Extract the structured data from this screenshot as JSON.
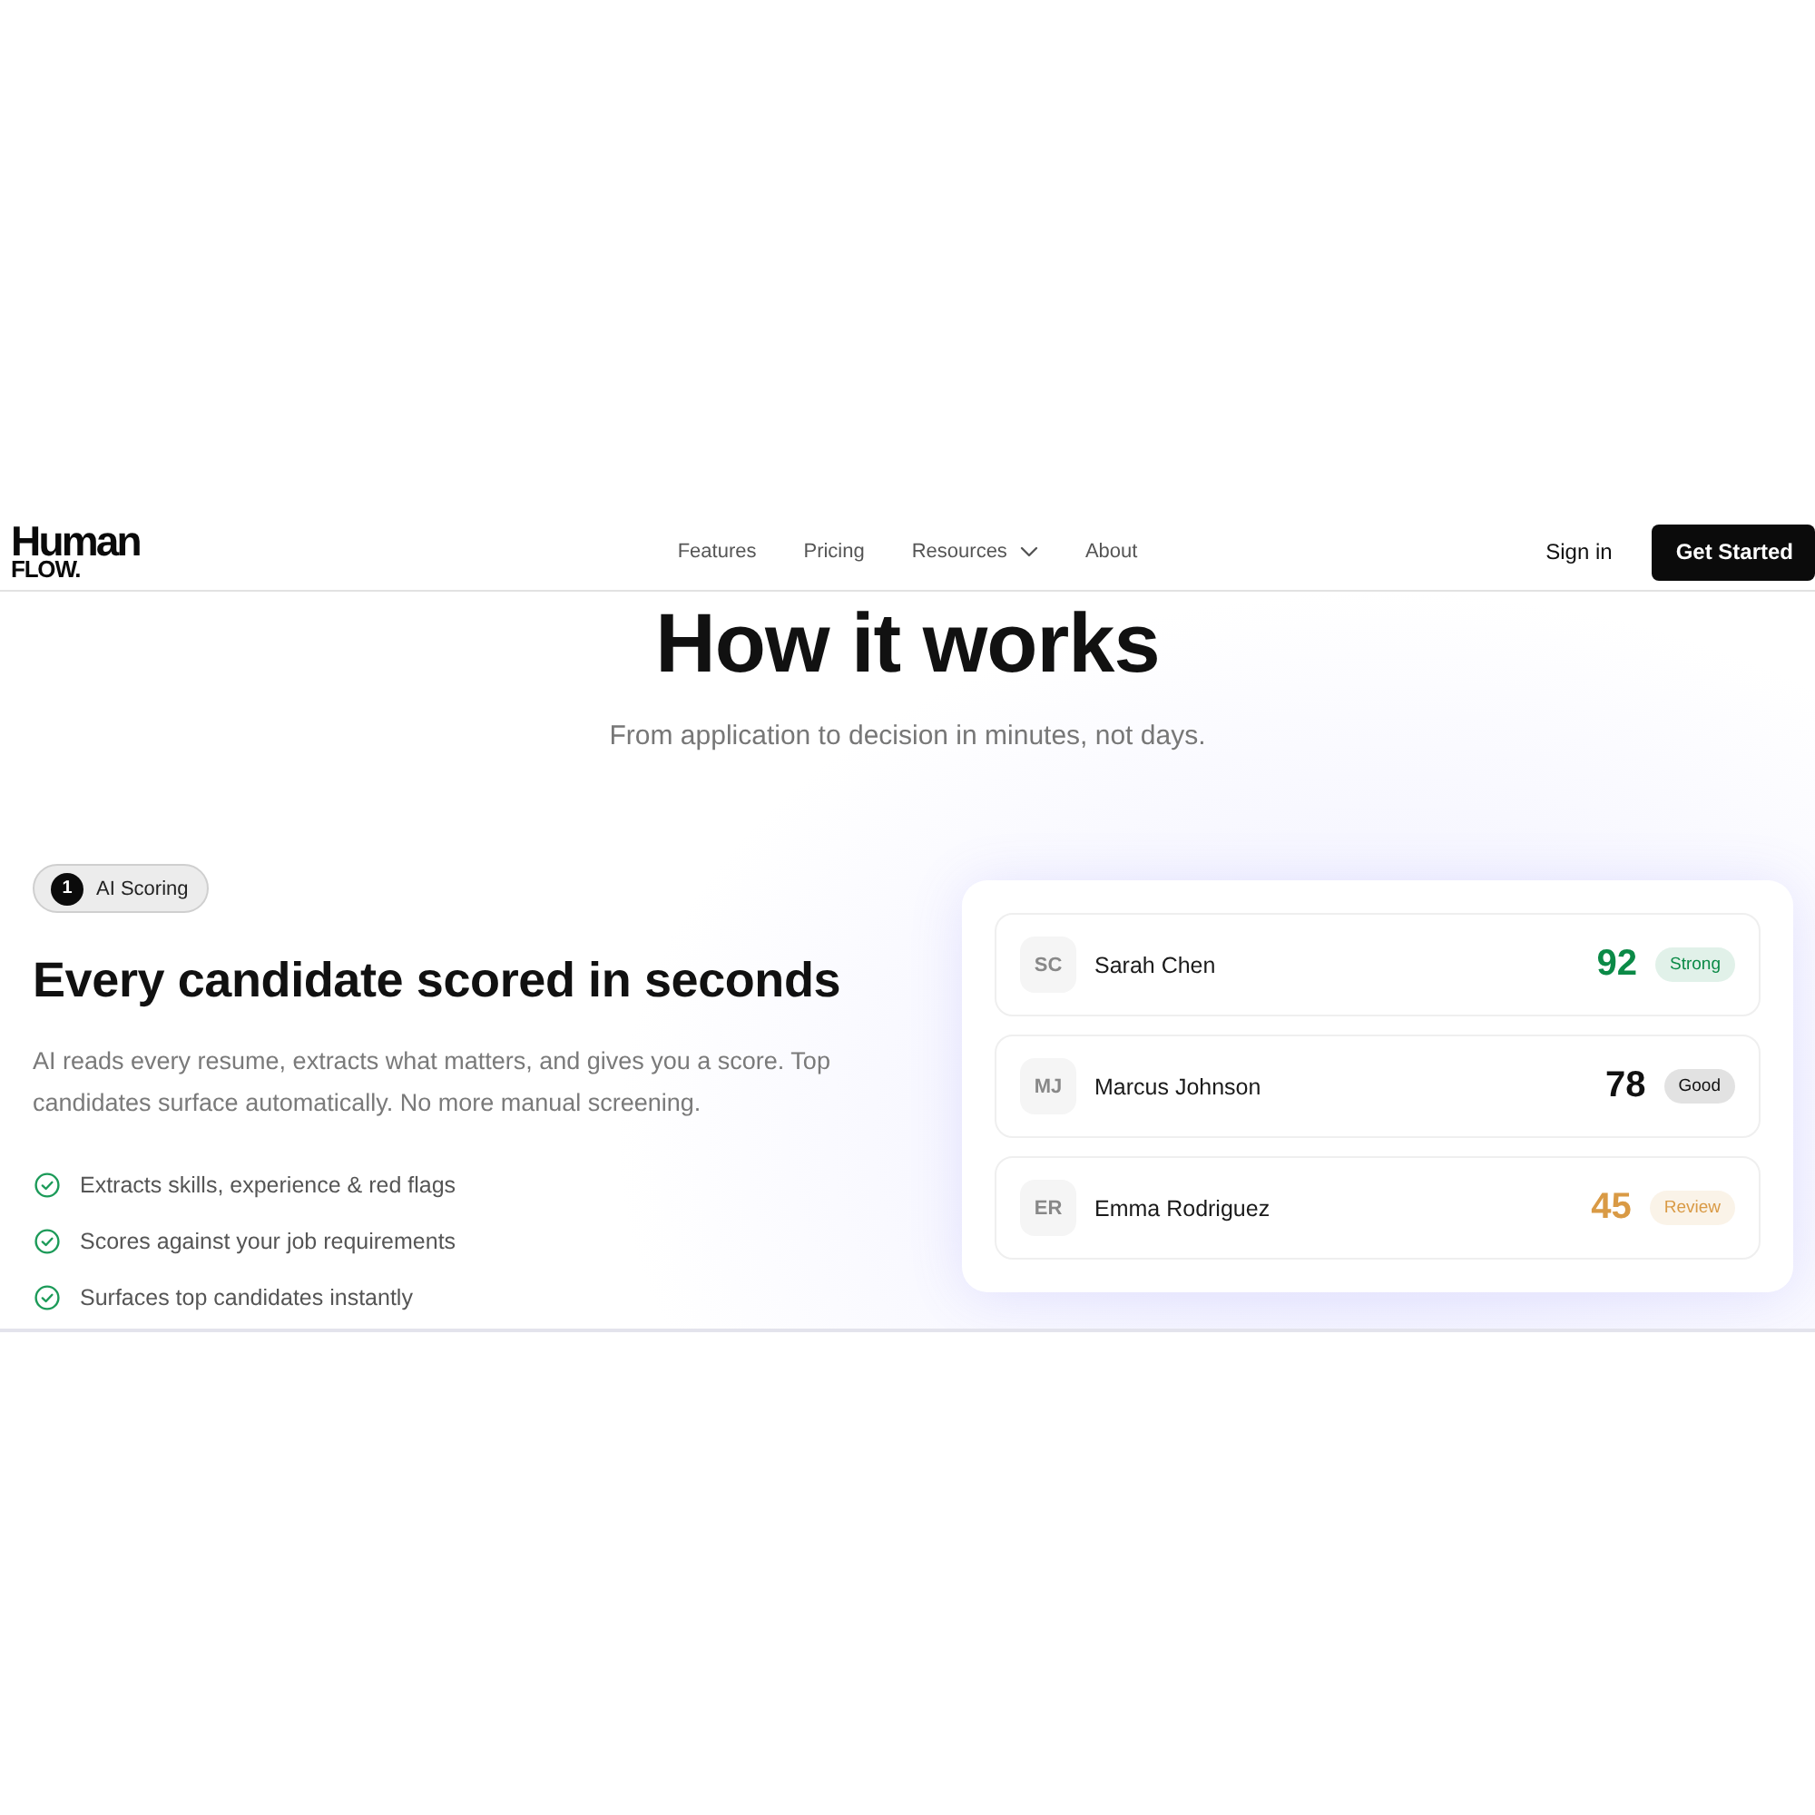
{
  "nav": {
    "logo": {
      "line_1": "Human",
      "line_2": "FLOW."
    },
    "links": [
      {
        "label": "Features",
        "dropdown": false
      },
      {
        "label": "Pricing",
        "dropdown": false
      },
      {
        "label": "Resources",
        "dropdown": true
      },
      {
        "label": "About",
        "dropdown": false
      }
    ],
    "sign_in": "Sign in",
    "cta": "Get Started"
  },
  "section": {
    "title": "How it works",
    "subtitle": "From application to decision in minutes, not days."
  },
  "step": {
    "number": "1",
    "label": "AI Scoring",
    "heading": "Every candidate scored in seconds",
    "description": "AI reads every resume, extracts what matters, and gives you a score. Top candidates surface automatically. No more manual screening.",
    "features": [
      "Extracts skills, experience & red flags",
      "Scores against your job requirements",
      "Surfaces top candidates instantly"
    ]
  },
  "candidates": [
    {
      "initials": "SC",
      "name": "Sarah Chen",
      "score": "92",
      "status": "Strong",
      "color": "#0b8a47"
    },
    {
      "initials": "MJ",
      "name": "Marcus Johnson",
      "score": "78",
      "status": "Good",
      "color": "#111111"
    },
    {
      "initials": "ER",
      "name": "Emma Rodriguez",
      "score": "45",
      "status": "Review",
      "color": "#d99a45"
    }
  ]
}
